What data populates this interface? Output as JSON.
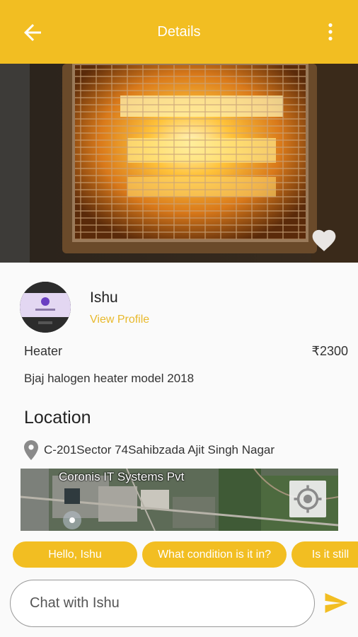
{
  "header": {
    "title": "Details",
    "back_icon": "arrow-left-icon",
    "menu_icon": "more-vertical-icon",
    "background_color": "#F2BE22"
  },
  "product": {
    "title": "Heater",
    "price": "₹2300",
    "description": "Bjaj halogen heater model 2018",
    "image": "halogen-heater-photo",
    "favorite_icon": "heart-icon"
  },
  "seller": {
    "name": "Ishu",
    "view_profile_label": "View Profile",
    "avatar": "seller-avatar"
  },
  "location": {
    "heading": "Location",
    "address": "C-201Sector 74Sahibzada Ajit Singh Nagar",
    "pin_icon": "location-pin-icon",
    "map_label": "Coronis IT Systems Pvt",
    "locate_icon": "my-location-icon"
  },
  "quick_replies": [
    "Hello, Ishu",
    "What condition is it in?",
    "Is it still"
  ],
  "chat": {
    "placeholder": "Chat with Ishu",
    "send_icon": "send-icon"
  },
  "accent_color": "#F2BE22",
  "link_color": "#E8B92C"
}
